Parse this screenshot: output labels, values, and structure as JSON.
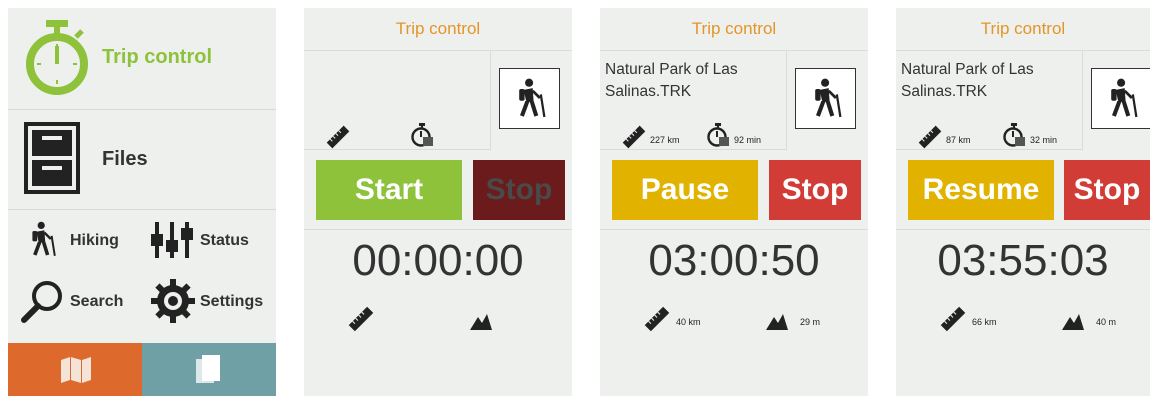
{
  "menu": {
    "trip_control": "Trip control",
    "files": "Files",
    "hiking": "Hiking",
    "status": "Status",
    "search": "Search",
    "settings": "Settings",
    "map_icon": "map-icon",
    "pages_icon": "pages-icon"
  },
  "colors": {
    "green": "#8dc23a",
    "orange_header": "#e4952a",
    "yellow_button": "#e1b200",
    "red_button": "#d23c37",
    "dark_red_button": "#6b1b1b",
    "map_tab": "#dd6a2c",
    "pages_tab": "#6fa0a5"
  },
  "screens": [
    {
      "header": "Trip control",
      "track_name": "",
      "distance": "",
      "duration": "",
      "primary_button": "Start",
      "secondary_button": "Stop",
      "timer": "00:00:00",
      "trip_distance": "",
      "elevation": ""
    },
    {
      "header": "Trip control",
      "track_name": "Natural Park of Las Salinas.TRK",
      "distance": "227 km",
      "duration": "92 min",
      "primary_button": "Pause",
      "secondary_button": "Stop",
      "timer": "03:00:50",
      "trip_distance": "40 km",
      "elevation": "29 m"
    },
    {
      "header": "Trip control",
      "track_name": "Natural Park of Las Salinas.TRK",
      "distance": "87 km",
      "duration": "32 min",
      "primary_button": "Resume",
      "secondary_button": "Stop",
      "timer": "03:55:03",
      "trip_distance": "66 km",
      "elevation": "40 m"
    }
  ]
}
